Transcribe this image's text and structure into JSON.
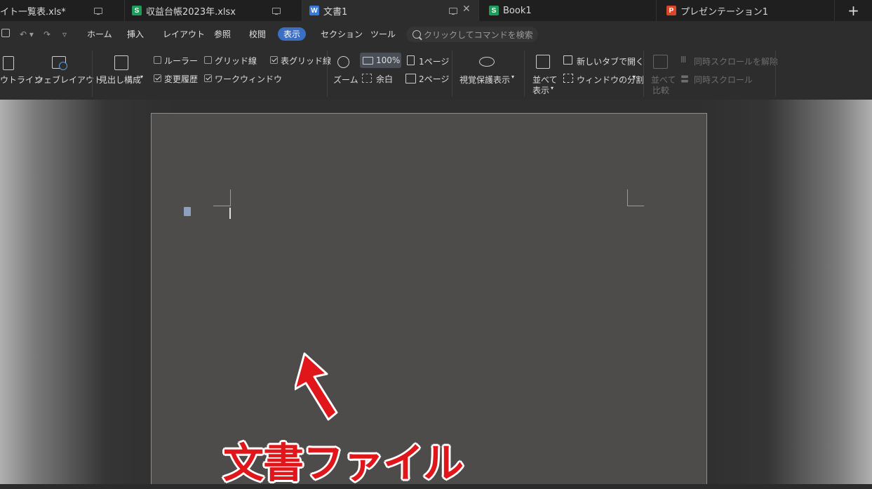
{
  "tabs": [
    {
      "title": "イト一覧表.xls*",
      "icon": "",
      "has_monitor": true
    },
    {
      "title": "収益台帳2023年.xlsx",
      "icon": "S",
      "has_monitor": true
    },
    {
      "title": "文書1",
      "icon": "W",
      "has_monitor": true,
      "active": true
    },
    {
      "title": "Book1",
      "icon": "S"
    },
    {
      "title": "プレゼンテーション1",
      "icon": "P"
    }
  ],
  "tab_new": "+",
  "menu": {
    "items": [
      "ホーム",
      "挿入",
      "レイアウト",
      "参照",
      "校閲",
      "表示",
      "セクション",
      "ツール"
    ],
    "active": "表示",
    "search_placeholder": "クリックしてコマンドを検索"
  },
  "ribbon": {
    "outline": "ウトライン",
    "web_layout": "ウェブレイアウト",
    "heading_structure": "見出し構成",
    "ruler": "ルーラー",
    "gridlines": "グリッド線",
    "table_gridlines": "表グリッド線",
    "revision_history": "変更履歴",
    "work_window": "ワークウィンドウ",
    "zoom": "ズーム",
    "zoom_value": "100%",
    "margin": "余白",
    "one_page": "1ページ",
    "two_pages": "2ページ",
    "eye_protection": "視覚保護表示",
    "side_by_side_1": "並べて",
    "side_by_side_2": "表示",
    "new_tab": "新しいタブで開く",
    "split_window": "ウィンドウの分割",
    "compare_1": "並べて",
    "compare_2": "比較",
    "sync_scroll_release": "同時スクロールを解除",
    "sync_scroll": "同時スクロール"
  },
  "caption": "文書ファイル",
  "colors": {
    "accent": "#3b6fc4",
    "caption": "#e0161a",
    "excel": "#1e9c5a",
    "writer": "#3a78d8",
    "presentation": "#d9472b"
  }
}
